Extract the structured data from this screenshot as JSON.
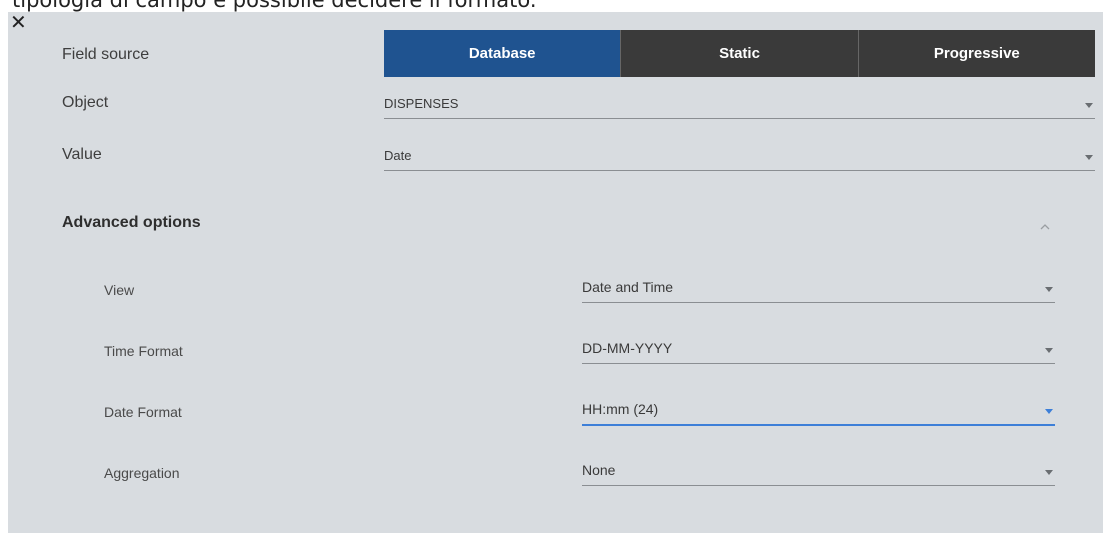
{
  "document": {
    "caption_fragment": "tipologia di campo è possibile decidere il formato."
  },
  "dialog": {
    "close_icon": "close-icon",
    "field_source": {
      "label": "Field source",
      "options": [
        "Database",
        "Static",
        "Progressive"
      ],
      "selected": "Database"
    },
    "object": {
      "label": "Object",
      "value": "DISPENSES"
    },
    "value": {
      "label": "Value",
      "value": "Date"
    },
    "advanced": {
      "title": "Advanced options",
      "expanded": true,
      "rows": [
        {
          "label": "View",
          "value": "Date and Time"
        },
        {
          "label": "Time Format",
          "value": "DD-MM-YYYY"
        },
        {
          "label": "Date Format",
          "value": "HH:mm (24)"
        },
        {
          "label": "Aggregation",
          "value": "None"
        }
      ]
    }
  },
  "colors": {
    "panel_bg": "#d8dce0",
    "active_segment": "#1f5390",
    "inactive_segment": "#3a3a3a",
    "focus_underline": "#3d7fd8"
  }
}
